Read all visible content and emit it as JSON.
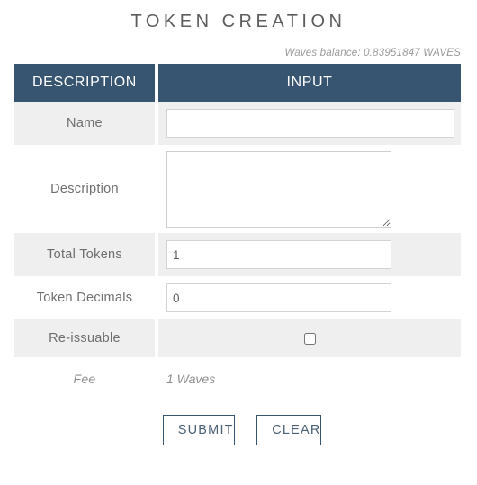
{
  "page": {
    "title": "TOKEN CREATION"
  },
  "balance": {
    "text": "Waves balance: 0.83951847 WAVES"
  },
  "table": {
    "headers": {
      "description": "DESCRIPTION",
      "input": "INPUT"
    },
    "rows": [
      {
        "label": "Name",
        "control": "text",
        "value": "",
        "placeholder": ""
      },
      {
        "label": "Description",
        "control": "textarea",
        "value": "",
        "placeholder": ""
      },
      {
        "label": "Total Tokens",
        "control": "text",
        "value": "1",
        "placeholder": ""
      },
      {
        "label": "Token Decimals",
        "control": "text",
        "value": "0",
        "placeholder": ""
      },
      {
        "label": "Re-issuable",
        "control": "checkbox",
        "value": "",
        "checked": false
      }
    ],
    "fee": {
      "label": "Fee",
      "value": "1 Waves"
    }
  },
  "buttons": {
    "submit": "SUBMIT",
    "clear": "CLEAR"
  },
  "colors": {
    "header_bg": "#375571",
    "row_shade": "#efefef",
    "page_bg": "#ffffff",
    "muted_text": "#9a9a9a",
    "button_border": "#375571"
  }
}
